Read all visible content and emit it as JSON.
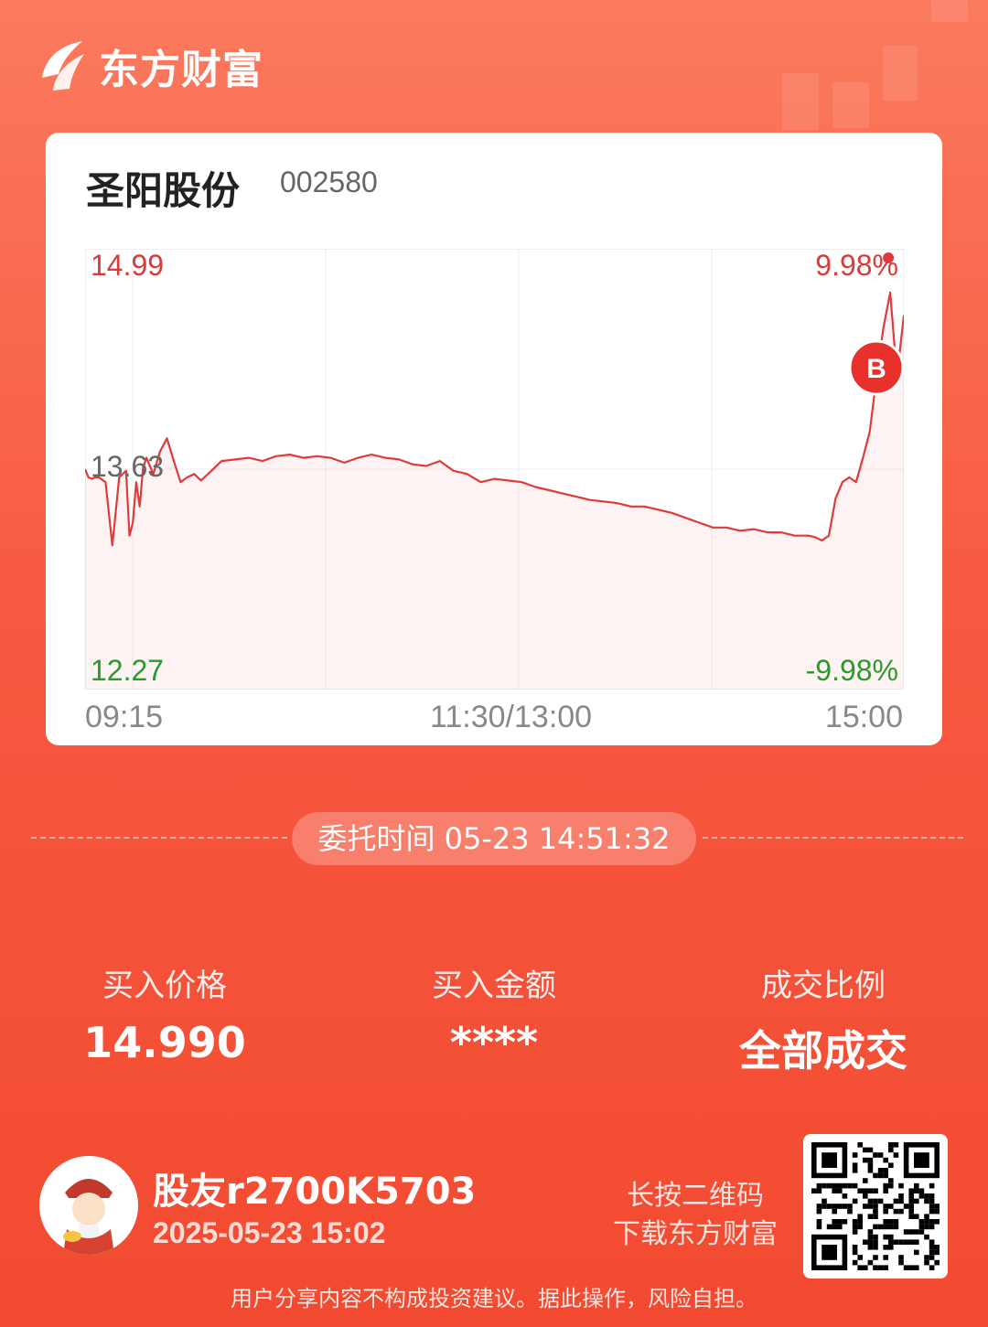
{
  "brand": {
    "name": "东方财富"
  },
  "stock": {
    "name": "圣阳股份",
    "code": "002580"
  },
  "chart_data": {
    "type": "line",
    "title": "",
    "xlabel": "",
    "ylabel": "",
    "ylim": [
      12.27,
      14.99
    ],
    "y_labels": {
      "top": "14.99",
      "mid": "13.63",
      "bottom": "12.27"
    },
    "pct_labels": {
      "top": "9.98%",
      "bottom": "-9.98%"
    },
    "x_tick_labels": [
      "09:15",
      "11:30/13:00",
      "15:00"
    ],
    "x_minutes_scale": [
      0,
      120,
      240
    ],
    "series": [
      {
        "x": [
          0,
          1,
          2,
          3,
          4,
          6,
          8,
          10,
          12,
          13,
          14,
          15,
          16,
          17,
          18,
          20,
          22,
          24,
          26,
          28,
          30,
          32,
          34,
          37,
          40,
          44,
          48,
          52,
          56,
          60,
          64,
          68,
          72,
          76,
          80,
          84,
          88,
          92,
          96,
          100,
          104,
          108,
          112,
          116,
          120,
          124,
          128,
          132,
          136,
          140,
          144,
          148,
          152,
          156,
          160,
          164,
          168,
          172,
          176,
          180,
          184,
          188,
          192,
          196,
          200,
          204,
          208,
          212,
          214,
          216,
          218,
          220,
          222,
          224,
          226,
          228,
          230,
          232,
          234,
          236,
          238,
          240
        ],
        "y": [
          13.63,
          13.58,
          13.57,
          13.58,
          13.58,
          13.55,
          13.16,
          13.58,
          13.62,
          13.22,
          13.3,
          13.55,
          13.4,
          13.64,
          13.7,
          13.6,
          13.74,
          13.82,
          13.68,
          13.55,
          13.58,
          13.6,
          13.56,
          13.62,
          13.68,
          13.69,
          13.7,
          13.68,
          13.71,
          13.72,
          13.7,
          13.71,
          13.7,
          13.67,
          13.7,
          13.72,
          13.7,
          13.69,
          13.66,
          13.65,
          13.68,
          13.62,
          13.6,
          13.55,
          13.57,
          13.56,
          13.55,
          13.52,
          13.5,
          13.48,
          13.46,
          13.44,
          13.43,
          13.42,
          13.4,
          13.4,
          13.38,
          13.36,
          13.33,
          13.3,
          13.27,
          13.27,
          13.25,
          13.26,
          13.24,
          13.24,
          13.22,
          13.22,
          13.21,
          13.19,
          13.22,
          13.45,
          13.55,
          13.58,
          13.55,
          13.7,
          13.86,
          14.2,
          14.5,
          14.72,
          14.2,
          14.58
        ]
      }
    ]
  },
  "order": {
    "time_text": "委托时间 05-23 14:51:32"
  },
  "stats": [
    {
      "label": "买入价格",
      "value": "14.990"
    },
    {
      "label": "买入金额",
      "value": "****"
    },
    {
      "label": "成交比例",
      "value": "全部成交"
    }
  ],
  "user": {
    "name": "股友r2700K5703",
    "datetime": "2025-05-23 15:02"
  },
  "hint": {
    "line1": "长按二维码",
    "line2": "下载东方财富"
  },
  "disclaimer": "用户分享内容不构成投资建议。据此操作，风险自担。",
  "colors": {
    "up": "#e03a3a",
    "down": "#2a9a2a",
    "buy_marker": "#e8312b",
    "price_line": "#e03a3a"
  },
  "icons": {
    "logo": "east-money-logo-icon",
    "buy": "buy-marker-icon",
    "qr": "qr-code"
  }
}
